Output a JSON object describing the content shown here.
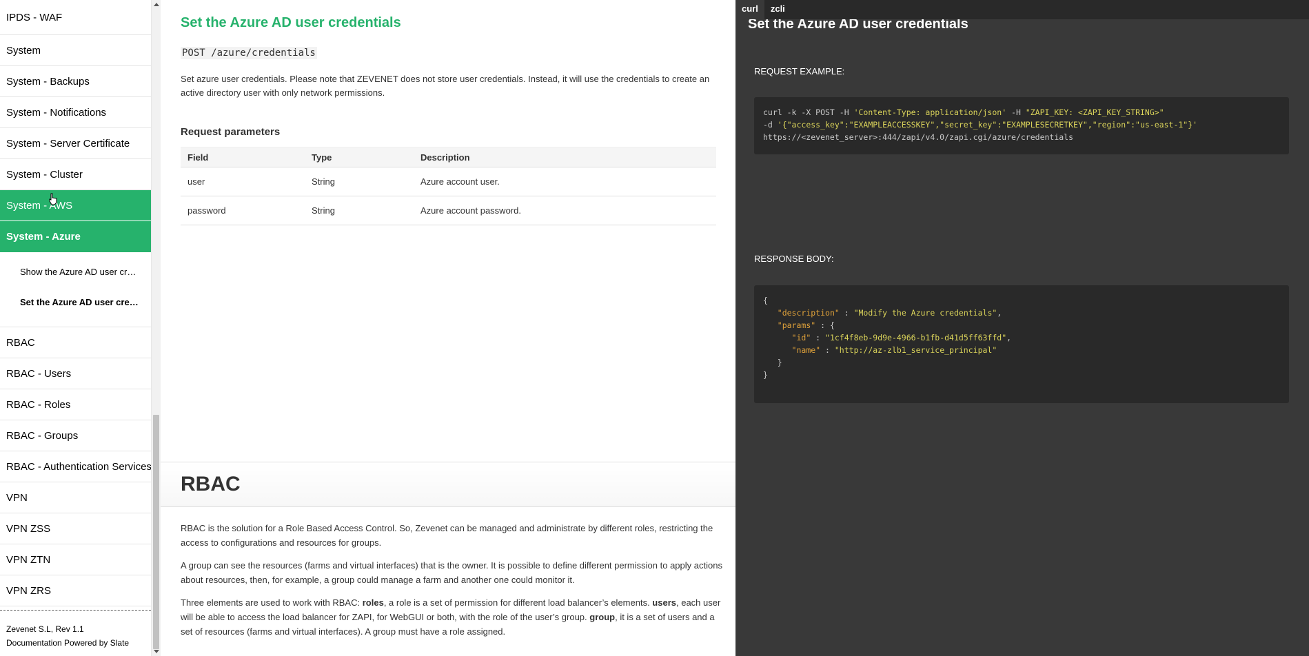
{
  "sidebar": {
    "items": [
      {
        "label": "IPDS - WAF"
      },
      {
        "label": "System"
      },
      {
        "label": "System - Backups"
      },
      {
        "label": "System - Notifications"
      },
      {
        "label": "System - Server Certificate"
      },
      {
        "label": "System - Cluster"
      },
      {
        "label": "System - AWS"
      },
      {
        "label": "System - Azure"
      }
    ],
    "subitems": [
      {
        "label": "Show the Azure AD user credentials"
      },
      {
        "label": "Set the Azure AD user credentials"
      }
    ],
    "items_after": [
      {
        "label": "RBAC"
      },
      {
        "label": "RBAC - Users"
      },
      {
        "label": "RBAC - Roles"
      },
      {
        "label": "RBAC - Groups"
      },
      {
        "label": "RBAC - Authentication Services"
      },
      {
        "label": "VPN"
      },
      {
        "label": "VPN ZSS"
      },
      {
        "label": "VPN ZTN"
      },
      {
        "label": "VPN ZRS"
      }
    ],
    "footer": {
      "line1": "Zevenet S.L, Rev 1.1",
      "line2": "Documentation Powered by Slate"
    }
  },
  "main": {
    "section_title": "Set the Azure AD user credentials",
    "endpoint": "POST /azure/credentials",
    "description": "Set azure user credentials. Please note that ZEVENET does not store user credentials. Instead, it will use the credentials to create an active directory user with only network permissions.",
    "params_title": "Request parameters",
    "params_headers": [
      "Field",
      "Type",
      "Description"
    ],
    "params_rows": [
      [
        "user",
        "String",
        "Azure account user."
      ],
      [
        "password",
        "String",
        "Azure account password."
      ]
    ],
    "rbac": {
      "title": "RBAC",
      "p1": "RBAC is the solution for a Role Based Access Control. So, Zevenet can be managed and administrate by different roles, restricting the access to configurations and resources for groups.",
      "p2": "A group can see the resources (farms and virtual interfaces) that is the owner. It is possible to define different permission to apply actions about resources, then, for example, a group could manage a farm and another one could monitor it.",
      "p3_intro": "Three elements are used to work with RBAC: ",
      "p3_roles": "roles",
      "p3_roles_text": ", a role is a set of permission for different load balancer’s elements. ",
      "p3_users": "users",
      "p3_users_text": ", each user will be able to access the load balancer for ZAPI, for WebGUI or both, with the role of the user’s group. ",
      "p3_group": "group",
      "p3_group_text": ", it is a set of users and a set of resources (farms and virtual interfaces). A group must have a role assigned."
    }
  },
  "code_panel": {
    "tabs": [
      "curl",
      "zcli"
    ],
    "active_tab": "curl",
    "title": "Set the Azure AD user credentials",
    "request_label": "REQUEST EXAMPLE:",
    "request": {
      "l1_cmd": "curl -k -X POST -H ",
      "l1_s1": "'Content-Type: application/json'",
      "l1_mid": " -H ",
      "l1_s2": "\"ZAPI_KEY: <ZAPI_KEY_STRING>\"",
      "l2_cmd": "-d ",
      "l2_s": "'{\"access_key\":\"EXAMPLEACCESSKEY\",\"secret_key\":\"EXAMPLESECRETKEY\",\"region\":\"us-east-1\"}'",
      "l3": "https://<zevenet_server>:444/zapi/v4.0/zapi.cgi/azure/credentials"
    },
    "response_label": "RESPONSE BODY:",
    "response": {
      "description_key": "\"description\"",
      "description_val": "\"Modify the Azure credentials\"",
      "params_key": "\"params\"",
      "id_key": "\"id\"",
      "id_val": "\"1cf4f8eb-9d9e-4966-b1fb-d41d5ff63ffd\"",
      "name_key": "\"name\"",
      "name_val": "\"http://az-zlb1_service_principal\""
    }
  }
}
